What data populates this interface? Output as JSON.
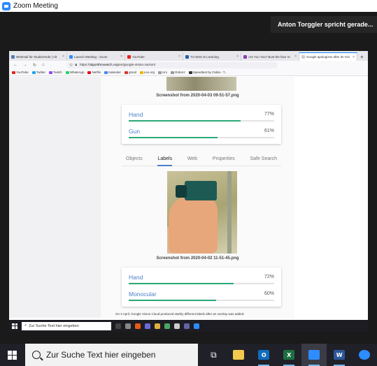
{
  "zoom": {
    "title": "Zoom Meeting",
    "speaker_notice": "Anton Torggler spricht gerade..."
  },
  "browser": {
    "tabs": [
      {
        "label": "Webmail für Studierende | Alt",
        "color": "#5a7ab8",
        "active": false
      },
      {
        "label": "Launch Meeting - Zoom",
        "color": "#2d8cff",
        "active": false
      },
      {
        "label": "YouTube",
        "color": "#e62117",
        "active": false
      },
      {
        "label": "TU Wien E-Learning",
        "color": "#1f5fa8",
        "active": false
      },
      {
        "label": "Are You You? Bust the face re",
        "color": "#8a3ab9",
        "active": false
      },
      {
        "label": "Google apologizes after its Visi",
        "color": "#cccccc",
        "active": true
      }
    ],
    "new_tab_label": "+",
    "url_prefix": "https://",
    "url_domain": "algorithmwatch.org",
    "url_path": "/en/google-vision-racism/",
    "bookmarks": [
      {
        "label": "YouTube",
        "color": "#e62117"
      },
      {
        "label": "Twitter",
        "color": "#1da1f2"
      },
      {
        "label": "Twitch",
        "color": "#9146ff"
      },
      {
        "label": "WhatsApp",
        "color": "#25d366"
      },
      {
        "label": "Netflix",
        "color": "#e50914"
      },
      {
        "label": "Kalender",
        "color": "#4285f4"
      },
      {
        "label": "gmail",
        "color": "#d93025"
      },
      {
        "label": "Leo.org",
        "color": "#f4b400"
      },
      {
        "label": "Uni",
        "color": "#999999"
      },
      {
        "label": "Ordenz",
        "color": "#999999"
      },
      {
        "label": "Speedtest by Ookla - T...",
        "color": "#333333"
      }
    ]
  },
  "article": {
    "caption_top": "Screenshot from 2020-04-03 09-51-57.png",
    "labels_top": [
      {
        "name": "Hand",
        "pct_text": "77%",
        "value": 0.77
      },
      {
        "name": "Gun",
        "pct_text": "61%",
        "value": 0.61
      }
    ],
    "tabs": [
      "Objects",
      "Labels",
      "Web",
      "Properties",
      "Safe Search"
    ],
    "active_tab": "Labels",
    "caption_bottom": "Screenshot from 2020-04-02 11-51-45.png",
    "labels_bottom": [
      {
        "name": "Hand",
        "pct_text": "72%",
        "value": 0.72
      },
      {
        "name": "Monocular",
        "pct_text": "60%",
        "value": 0.6
      }
    ],
    "note": "On 3 April, Google Vision Cloud produced starkly different labels after an overlay was added."
  },
  "remote_taskbar": {
    "search_placeholder": "Zur Suche Text hier eingeben"
  },
  "taskbar": {
    "search_placeholder": "Zur Suche Text hier eingeben",
    "apps": [
      {
        "name": "task-view",
        "glyph": "",
        "color": "#202028"
      },
      {
        "name": "file-explorer",
        "glyph": "",
        "color": "#f2c94c"
      },
      {
        "name": "outlook",
        "glyph": "O",
        "color": "#0f6cbd"
      },
      {
        "name": "excel",
        "glyph": "X",
        "color": "#1d6f42"
      },
      {
        "name": "zoom",
        "glyph": "",
        "color": "#2d8cff"
      },
      {
        "name": "word",
        "glyph": "W",
        "color": "#2b579a"
      },
      {
        "name": "chat",
        "glyph": "",
        "color": "#2d8cff"
      }
    ]
  }
}
